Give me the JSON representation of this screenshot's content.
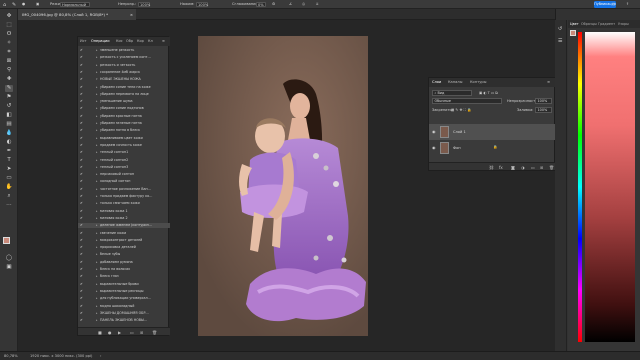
{
  "options_bar": {
    "mode_label": "Режим:",
    "mode_value": "Нормальный",
    "opacity_label": "Непрозр.:",
    "opacity_value": "100%",
    "flow_label": "Нажим:",
    "flow_value": "100%",
    "smooth_label": "Сглаживание:",
    "smooth_value": "0%",
    "publish_label": "Публикация"
  },
  "document": {
    "tab_title": "IMG_004096.jpg @ 80,8% (Слой 1, RGB/8*) *"
  },
  "actions_panel": {
    "tabs": [
      "Ист",
      "Операции",
      "Кис",
      "Обр",
      "Кор",
      "Кл"
    ],
    "rows": [
      {
        "label": "зменшене резкость",
        "caret": ">",
        "selected": false
      },
      {
        "label": "резкость с усилением конт…",
        "caret": ">",
        "selected": false
      },
      {
        "label": "резкость и четкость",
        "caret": ">",
        "selected": false
      },
      {
        "label": "сохранение 4мб жарск",
        "caret": ">",
        "selected": false
      },
      {
        "label": "НОВЫЕ ЭКШЕНЫ КОЖА",
        "caret": "v",
        "selected": false
      },
      {
        "label": "убираем синие тени на коже",
        "caret": ">",
        "selected": false
      },
      {
        "label": "убираем перехвата на лице",
        "caret": ">",
        "selected": false
      },
      {
        "label": "уменьшение шума",
        "caret": ">",
        "selected": false
      },
      {
        "label": "убираем синие подтонов",
        "caret": ">",
        "selected": false
      },
      {
        "label": "убираем красные пятна",
        "caret": ">",
        "selected": false
      },
      {
        "label": "убираем зеленые пятна",
        "caret": ">",
        "selected": false
      },
      {
        "label": "убираем пятна в блеск",
        "caret": ">",
        "selected": false
      },
      {
        "label": "выравниваем цвет кожи",
        "caret": ">",
        "selected": false
      },
      {
        "label": "придаем сочность коже",
        "caret": ">",
        "selected": false
      },
      {
        "label": "теплый сонтон1",
        "caret": ">",
        "selected": false
      },
      {
        "label": "теплый сонтон2",
        "caret": ">",
        "selected": false
      },
      {
        "label": "теплый сонтон3",
        "caret": ">",
        "selected": false
      },
      {
        "label": "персиковый сонтон",
        "caret": ">",
        "selected": false
      },
      {
        "label": "холодный сонтон",
        "caret": ">",
        "selected": false
      },
      {
        "label": "частотное разложение Ван…",
        "caret": ">",
        "selected": false
      },
      {
        "label": "только придаем фактуру ко…",
        "caret": ">",
        "selected": false
      },
      {
        "label": "только смягчаем кожи",
        "caret": ">",
        "selected": false
      },
      {
        "label": "матовая кожа 1",
        "caret": ">",
        "selected": false
      },
      {
        "label": "матовая кожа 2",
        "caret": ">",
        "selected": false
      },
      {
        "label": "деление жменем (контурин…",
        "caret": ">",
        "selected": true
      },
      {
        "label": "свечение кожи",
        "caret": ">",
        "selected": false
      },
      {
        "label": "микроконтраст деталей",
        "caret": ">",
        "selected": false
      },
      {
        "label": "прорисовка деталей",
        "caret": ">",
        "selected": false
      },
      {
        "label": "белые зубы",
        "caret": ">",
        "selected": false
      },
      {
        "label": "добавляем румяна",
        "caret": ">",
        "selected": false
      },
      {
        "label": "блеск на волосах",
        "caret": ">",
        "selected": false
      },
      {
        "label": "блеск глаз",
        "caret": ">",
        "selected": false
      },
      {
        "label": "выразительные брови",
        "caret": ">",
        "selected": false
      },
      {
        "label": "выразительные ресницы",
        "caret": ">",
        "selected": false
      },
      {
        "label": "для публикации универсал…",
        "caret": ">",
        "selected": false
      },
      {
        "label": "модно шоколадный",
        "caret": ">",
        "selected": false
      },
      {
        "label": "ЭКШЕНЫ ДОМАШНЯЯ ОБР…",
        "caret": ">",
        "selected": false
      },
      {
        "label": "ПАНЕЛЬ ЭКШЕНОВ НОВЫ…",
        "caret": ">",
        "selected": false
      }
    ]
  },
  "layers_panel": {
    "tabs": [
      "Слои",
      "Каналы",
      "Контуры"
    ],
    "kind_value": "Вид",
    "blend_value": "Обычные",
    "opacity_label": "Непрозрачность:",
    "opacity_value": "100%",
    "lock_label": "Закрепить:",
    "fill_label": "Заливка:",
    "fill_value": "100%",
    "layers": [
      {
        "name": "Слой 1",
        "selected": true
      },
      {
        "name": "Фон",
        "selected": false
      }
    ]
  },
  "color_panel": {
    "tabs": [
      "Цвет",
      "Образцы",
      "Градиент",
      "Узоры"
    ]
  },
  "status_bar": {
    "zoom": "80,78%",
    "doc_size": "1920 пикс. x 3000 пикс. (300 ppi)"
  }
}
